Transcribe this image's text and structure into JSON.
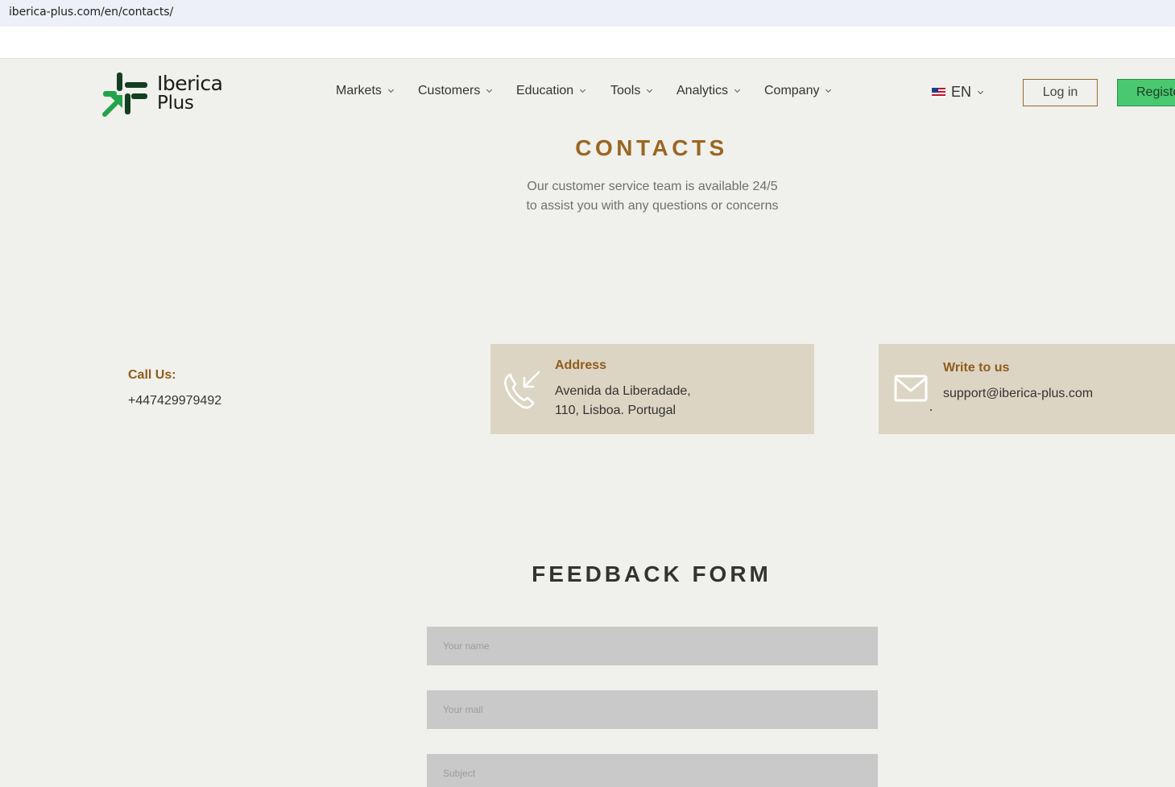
{
  "browser": {
    "url": "iberica-plus.com/en/contacts/"
  },
  "logo": {
    "line1": "Iberica",
    "line2": "Plus"
  },
  "nav": {
    "items": [
      {
        "label": "Markets"
      },
      {
        "label": "Customers"
      },
      {
        "label": "Education"
      },
      {
        "label": "Tools"
      },
      {
        "label": "Analytics"
      },
      {
        "label": "Company"
      }
    ]
  },
  "lang": {
    "code": "EN"
  },
  "auth": {
    "login_label": "Log in",
    "register_label": "Register"
  },
  "contacts": {
    "title": "CONTACTS",
    "subtitle_line1": "Our customer service team is available 24/5",
    "subtitle_line2": "to assist you with any questions or concerns",
    "call": {
      "label": "Call Us:",
      "number": "+447429979492"
    },
    "address": {
      "title": "Address",
      "line1": "Avenida da Liberadade,",
      "line2": "110, Lisboa. Portugal"
    },
    "mail": {
      "title": "Write to us",
      "email": "support@iberica-plus.com"
    }
  },
  "feedback": {
    "title": "FEEDBACK FORM",
    "name_placeholder": "Your name",
    "mail_placeholder": "Your mail",
    "subject_placeholder": "Subject"
  },
  "colors": {
    "accent_brown": "#9b6622",
    "card_bg": "#ddd5c3",
    "register_green": "#49c870",
    "page_bg": "#f0f0ec"
  }
}
